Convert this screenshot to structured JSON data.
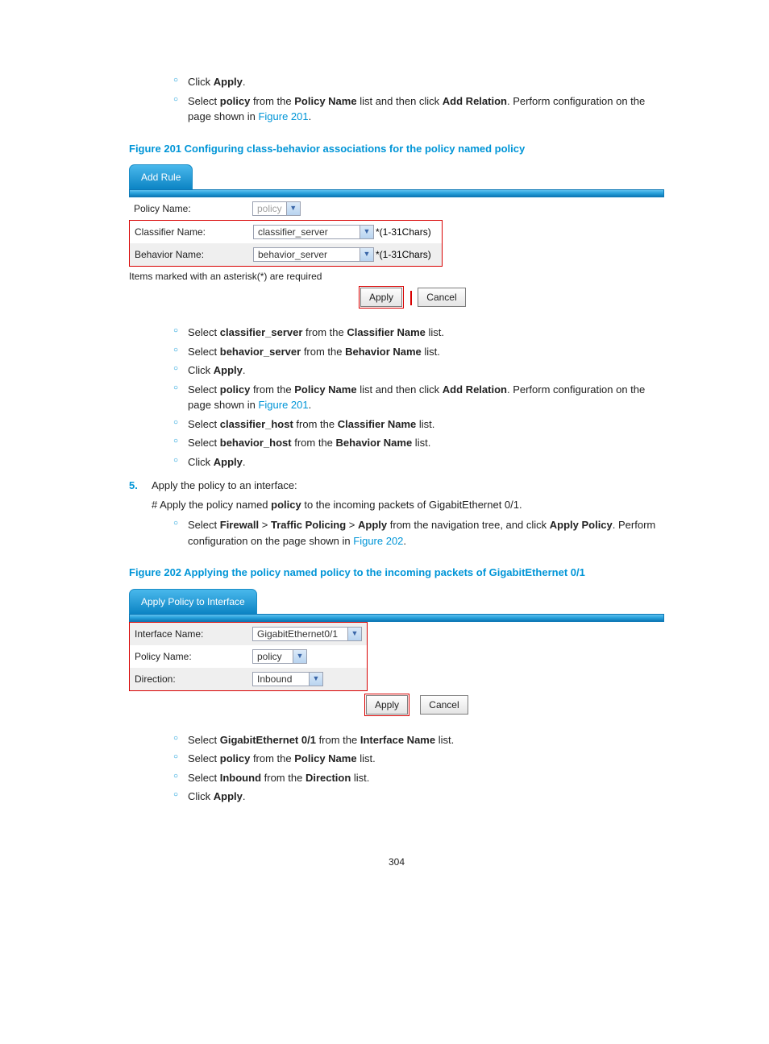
{
  "intro_list": [
    {
      "prefix": "Click ",
      "bold1": "Apply",
      "suffix": "."
    },
    {
      "prefix": "Select ",
      "bold1": "policy",
      "mid1": " from the ",
      "bold2": "Policy Name",
      "mid2": " list and then click ",
      "bold3": "Add Relation",
      "suffix": ". Perform configuration on the page shown in ",
      "ref": "Figure 201",
      "tail": "."
    }
  ],
  "fig201": {
    "caption": "Figure 201 Configuring class-behavior associations for the policy named policy",
    "tab": "Add Rule",
    "rows": {
      "policy_label": "Policy Name:",
      "policy_value": "policy",
      "classifier_label": "Classifier Name:",
      "classifier_value": "classifier_server",
      "classifier_hint": "*(1-31Chars)",
      "behavior_label": "Behavior Name:",
      "behavior_value": "behavior_server",
      "behavior_hint": "*(1-31Chars)"
    },
    "note": "Items marked with an asterisk(*) are required",
    "apply": "Apply",
    "cancel": "Cancel"
  },
  "mid_list": [
    {
      "prefix": "Select ",
      "bold1": "classifier_server",
      "mid1": " from the ",
      "bold2": "Classifier Name",
      "suffix": " list."
    },
    {
      "prefix": "Select ",
      "bold1": "behavior_server",
      "mid1": " from the ",
      "bold2": "Behavior Name",
      "suffix": " list."
    },
    {
      "prefix": "Click ",
      "bold1": "Apply",
      "suffix": "."
    },
    {
      "prefix": "Select ",
      "bold1": "policy",
      "mid1": " from the ",
      "bold2": "Policy Name",
      "mid2": " list and then click ",
      "bold3": "Add Relation",
      "suffix": ". Perform configuration on the page shown in ",
      "ref": "Figure 201",
      "tail": "."
    },
    {
      "prefix": "Select ",
      "bold1": "classifier_host",
      "mid1": " from the ",
      "bold2": "Classifier Name",
      "suffix": " list."
    },
    {
      "prefix": "Select ",
      "bold1": "behavior_host",
      "mid1": " from the ",
      "bold2": "Behavior Name",
      "suffix": " list."
    },
    {
      "prefix": "Click ",
      "bold1": "Apply",
      "suffix": "."
    }
  ],
  "step5": {
    "num": "5.",
    "text": "Apply the policy to an interface:",
    "sub1_prefix": "# Apply the policy named ",
    "sub1_bold": "policy",
    "sub1_suffix": " to the incoming packets of GigabitEthernet 0/1.",
    "bullet": {
      "prefix": "Select ",
      "b1": "Firewall",
      "gt1": " > ",
      "b2": "Traffic Policing",
      "gt2": " > ",
      "b3": "Apply",
      "mid": " from the navigation tree, and click ",
      "b4": "Apply Policy",
      "suffix": ". Perform configuration on the page shown in ",
      "ref": "Figure 202",
      "tail": "."
    }
  },
  "fig202": {
    "caption": "Figure 202 Applying the policy named policy to the incoming packets of GigabitEthernet 0/1",
    "tab": "Apply Policy to Interface",
    "rows": {
      "iface_label": "Interface Name:",
      "iface_value": "GigabitEthernet0/1",
      "policy_label": "Policy Name:",
      "policy_value": "policy",
      "dir_label": "Direction:",
      "dir_value": "Inbound"
    },
    "apply": "Apply",
    "cancel": "Cancel"
  },
  "end_list": [
    {
      "prefix": "Select ",
      "bold1": "GigabitEthernet 0/1",
      "mid1": " from the ",
      "bold2": "Interface Name",
      "suffix": " list."
    },
    {
      "prefix": "Select ",
      "bold1": "policy",
      "mid1": " from the ",
      "bold2": "Policy Name",
      "suffix": " list."
    },
    {
      "prefix": "Select ",
      "bold1": "Inbound",
      "mid1": " from the ",
      "bold2": "Direction",
      "suffix": " list."
    },
    {
      "prefix": "Click ",
      "bold1": "Apply",
      "suffix": "."
    }
  ],
  "page_number": "304"
}
